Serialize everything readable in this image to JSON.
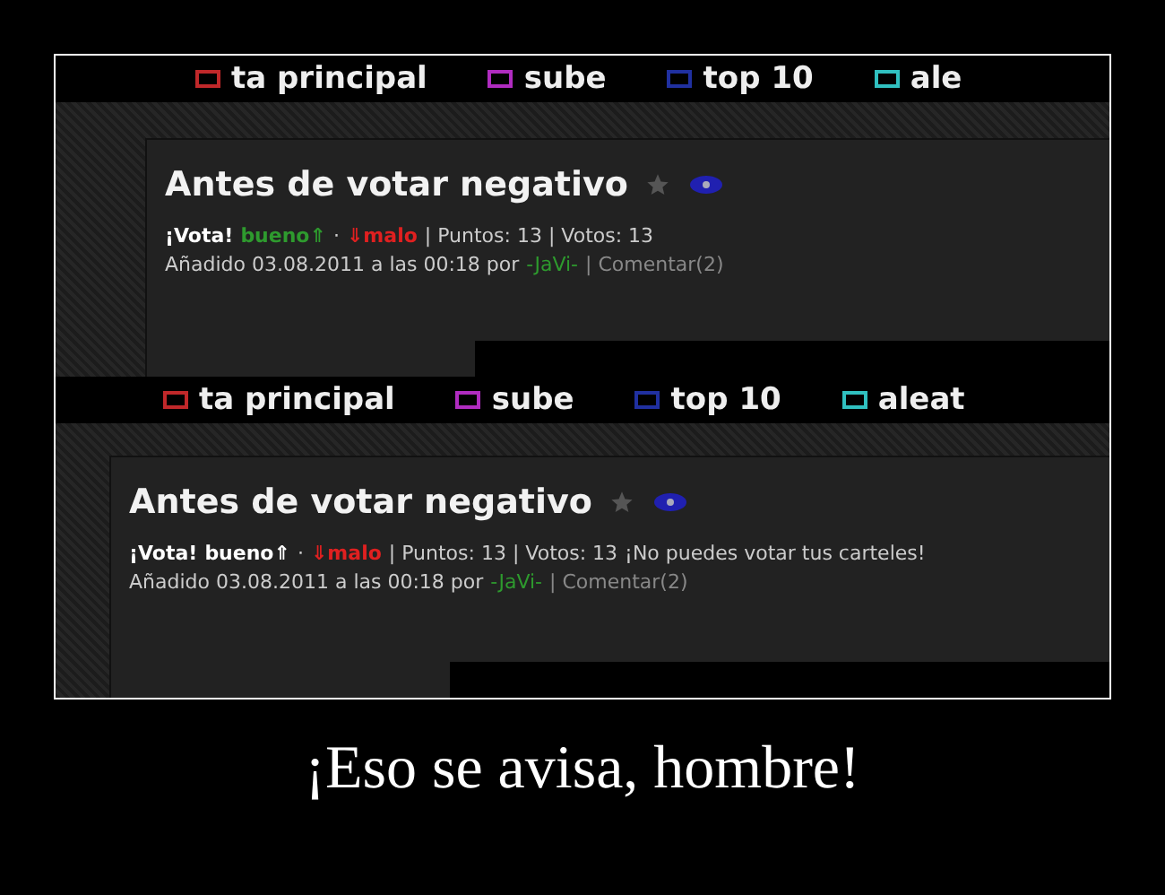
{
  "screenshots": [
    {
      "nav": [
        {
          "label": "ta principal",
          "color": "#c0282a"
        },
        {
          "label": "sube",
          "color": "#b02cc0"
        },
        {
          "label": "top 10",
          "color": "#2030a0"
        },
        {
          "label": "ale",
          "color": "#30c0c0"
        }
      ],
      "title": "Antes de votar negativo",
      "vote": "¡Vota!",
      "good": {
        "label": "bueno⇑",
        "color": "#2e9a2e"
      },
      "separator": "·",
      "bad": "⇓malo",
      "stats": "| Puntos: 13 | Votos: 13",
      "added": "Añadido 03.08.2011 a las 00:18 por",
      "author": "-JaVi-",
      "comment": "| Comentar(2)"
    },
    {
      "nav": [
        {
          "label": "ta principal",
          "color": "#c0282a"
        },
        {
          "label": "sube",
          "color": "#b02cc0"
        },
        {
          "label": "top 10",
          "color": "#2030a0"
        },
        {
          "label": "aleat",
          "color": "#30c0c0"
        }
      ],
      "title": "Antes de votar negativo",
      "vote": "¡Vota!",
      "good": {
        "label": "bueno⇑",
        "color": "#ffffff"
      },
      "separator": "·",
      "bad": "⇓malo",
      "stats": "| Puntos: 13 | Votos: 13",
      "notice": "¡No puedes votar tus carteles!",
      "added": "Añadido 03.08.2011 a las 00:18 por",
      "author": "-JaVi-",
      "comment": "| Comentar(2)"
    }
  ],
  "caption": "¡Eso se avisa, hombre!"
}
